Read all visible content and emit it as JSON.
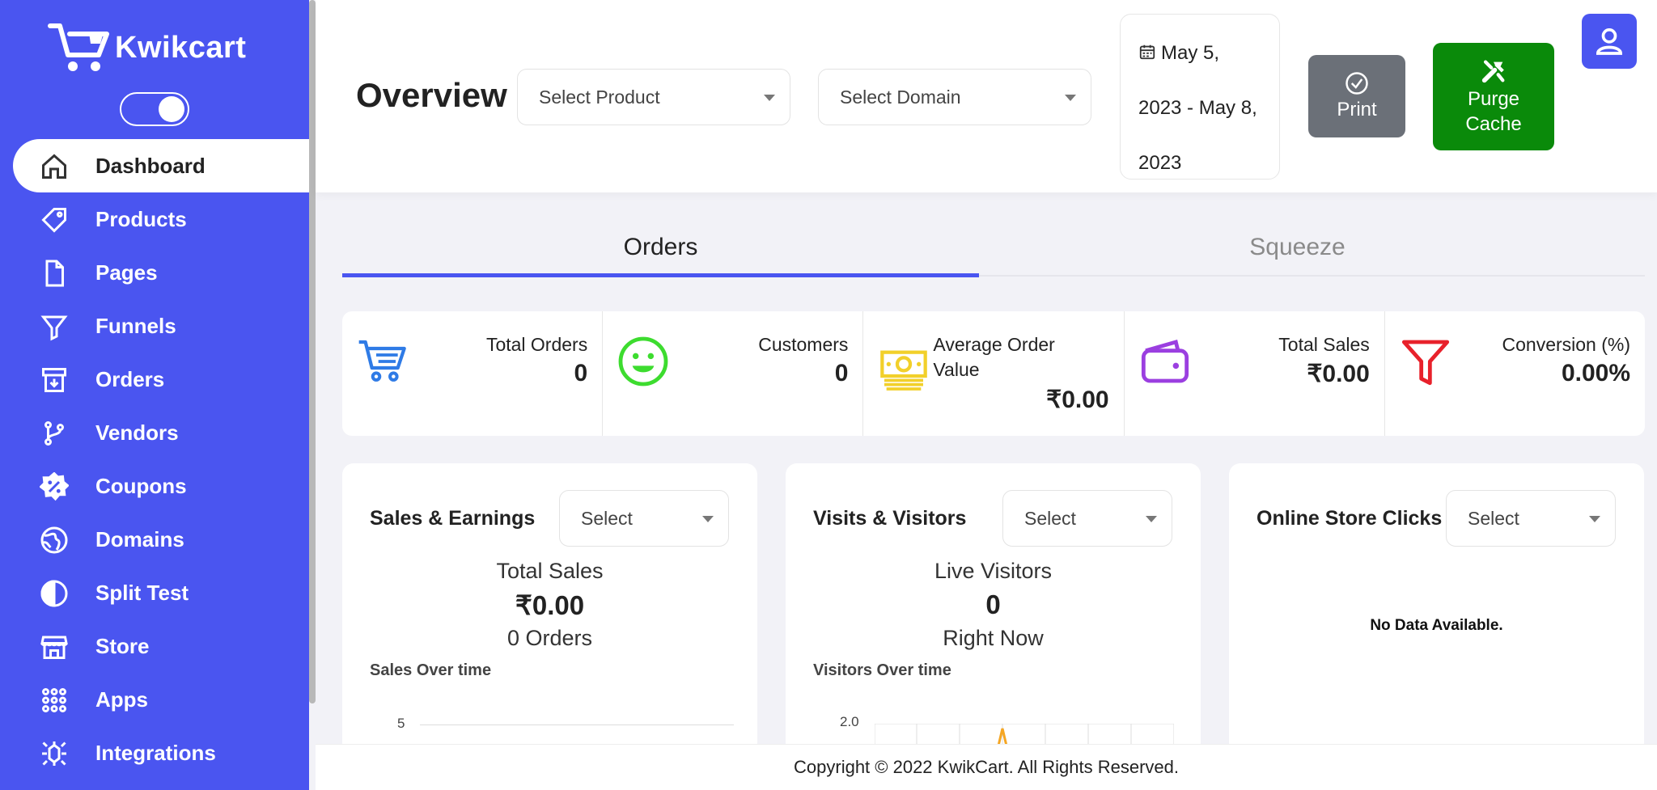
{
  "brand": {
    "name": "Kwikcart"
  },
  "sidebar": {
    "items": [
      {
        "label": "Dashboard",
        "icon": "home-icon",
        "active": true
      },
      {
        "label": "Products",
        "icon": "tag-icon"
      },
      {
        "label": "Pages",
        "icon": "file-icon"
      },
      {
        "label": "Funnels",
        "icon": "funnel-icon"
      },
      {
        "label": "Orders",
        "icon": "archive-icon"
      },
      {
        "label": "Vendors",
        "icon": "git-branch-icon"
      },
      {
        "label": "Coupons",
        "icon": "percent-badge-icon"
      },
      {
        "label": "Domains",
        "icon": "globe-icon"
      },
      {
        "label": "Split Test",
        "icon": "half-circle-icon"
      },
      {
        "label": "Store",
        "icon": "store-icon"
      },
      {
        "label": "Apps",
        "icon": "grid-dots-icon"
      },
      {
        "label": "Integrations",
        "icon": "integrations-icon"
      }
    ]
  },
  "header": {
    "title": "Overview",
    "product_select": "Select Product",
    "domain_select": "Select Domain",
    "date_range": "May 5, 2023 - May 8, 2023",
    "print_label": "Print",
    "purge_label": "Purge Cache"
  },
  "tabs": [
    {
      "label": "Orders",
      "active": true
    },
    {
      "label": "Squeeze",
      "active": false
    }
  ],
  "stats": {
    "total_orders": {
      "label": "Total Orders",
      "value": "0"
    },
    "customers": {
      "label": "Customers",
      "value": "0"
    },
    "aov": {
      "label": "Average Order Value",
      "value": "₹0.00"
    },
    "total_sales": {
      "label": "Total Sales",
      "value": "₹0.00"
    },
    "conversion": {
      "label": "Conversion (%)",
      "value": "0.00%"
    }
  },
  "cards": {
    "sales": {
      "title": "Sales & Earnings",
      "select": "Select",
      "metric_label": "Total Sales",
      "metric_value": "₹0.00",
      "metric_sub": "0 Orders",
      "chart_title": "Sales Over time",
      "y_tick": "5"
    },
    "visits": {
      "title": "Visits & Visitors",
      "select": "Select",
      "metric_label": "Live Visitors",
      "metric_value": "0",
      "metric_sub": "Right Now",
      "chart_title": "Visitors Over time",
      "y_tick": "2.0"
    },
    "clicks": {
      "title": "Online Store Clicks",
      "select": "Select",
      "empty": "No Data Available."
    }
  },
  "footer": {
    "text": "Copyright © 2022 KwikCart. All Rights Reserved."
  },
  "colors": {
    "primary": "#4a55f0",
    "purge": "#0a8a0a",
    "print": "#6b7078",
    "cart": "#2f7be6",
    "smiley": "#3ddc2f",
    "money": "#f2d02a",
    "wallet": "#9b3fe0",
    "conversion": "#e8212b",
    "chart_line": "#f5a623"
  }
}
